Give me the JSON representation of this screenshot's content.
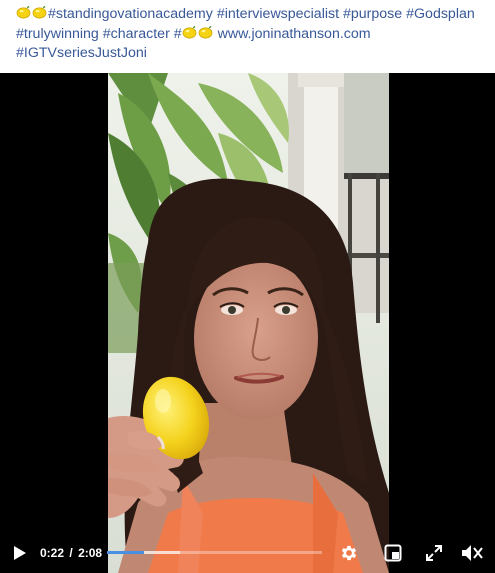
{
  "post": {
    "caption_parts": [
      {
        "type": "emoji",
        "icon": "lemon-emoji"
      },
      {
        "type": "emoji",
        "icon": "lemon-emoji"
      },
      {
        "type": "tag",
        "text": "#standingovationacademy"
      },
      {
        "type": "text",
        "text": " "
      },
      {
        "type": "tag",
        "text": "#interviewspecialist"
      },
      {
        "type": "text",
        "text": " "
      },
      {
        "type": "tag",
        "text": "#purpose"
      },
      {
        "type": "text",
        "text": " "
      },
      {
        "type": "tag",
        "text": "#Godsplan"
      },
      {
        "type": "text",
        "text": " "
      },
      {
        "type": "tag",
        "text": "#trulywinning"
      },
      {
        "type": "text",
        "text": " "
      },
      {
        "type": "tag",
        "text": "#character"
      },
      {
        "type": "text",
        "text": " #"
      },
      {
        "type": "emoji",
        "icon": "lemon-emoji"
      },
      {
        "type": "emoji",
        "icon": "lemon-emoji"
      },
      {
        "type": "text",
        "text": " "
      },
      {
        "type": "link",
        "text": "www.joninathanson.com"
      },
      {
        "type": "text",
        "text": " "
      },
      {
        "type": "tag",
        "text": "#IGTVseriesJustJoni"
      }
    ]
  },
  "player": {
    "current_time": "0:22",
    "separator": "/",
    "duration": "2:08",
    "played_fraction": 0.172,
    "buffered_fraction": 0.34,
    "icons": {
      "play": "play-icon",
      "settings": "gear-icon",
      "pip": "picture-in-picture-icon",
      "fullscreen": "fullscreen-icon",
      "volume": "muted-volume-icon"
    },
    "colors": {
      "progress": "#4a90e2",
      "link": "#385898"
    }
  }
}
